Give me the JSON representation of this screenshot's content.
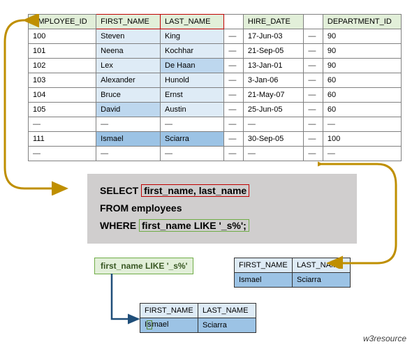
{
  "table": {
    "headers": {
      "id": "EMPLOYEE_ID",
      "fn": "FIRST_NAME",
      "ln": "LAST_NAME",
      "hire": "HIRE_DATE",
      "dept": "DEPARTMENT_ID"
    },
    "rows": [
      {
        "id": "100",
        "fn": "Steven",
        "ln": "King",
        "hire": "17-Jun-03",
        "dept": "90",
        "fn_cls": "lt-blue",
        "ln_cls": "lt-blue"
      },
      {
        "id": "101",
        "fn": "Neena",
        "ln": "Kochhar",
        "hire": "21-Sep-05",
        "dept": "90",
        "fn_cls": "lt-blue",
        "ln_cls": "lt-blue"
      },
      {
        "id": "102",
        "fn": "Lex",
        "ln": "De Haan",
        "hire": "13-Jan-01",
        "dept": "90",
        "fn_cls": "lt-blue",
        "ln_cls": "md-blue"
      },
      {
        "id": "103",
        "fn": "Alexander",
        "ln": "Hunold",
        "hire": "3-Jan-06",
        "dept": "60",
        "fn_cls": "lt-blue",
        "ln_cls": "lt-blue"
      },
      {
        "id": "104",
        "fn": "Bruce",
        "ln": "Ernst",
        "hire": "21-May-07",
        "dept": "60",
        "fn_cls": "lt-blue",
        "ln_cls": "lt-blue"
      },
      {
        "id": "105",
        "fn": "David",
        "ln": "Austin",
        "hire": "25-Jun-05",
        "dept": "60",
        "fn_cls": "md-blue",
        "ln_cls": "lt-blue"
      },
      {
        "id": "",
        "fn": "",
        "ln": "",
        "hire": "",
        "dept": "",
        "fn_cls": "",
        "ln_cls": ""
      },
      {
        "id": "111",
        "fn": "Ismael",
        "ln": "Sciarra",
        "hire": "30-Sep-05",
        "dept": "100",
        "fn_cls": "dk-blue",
        "ln_cls": "dk-blue"
      },
      {
        "id": "",
        "fn": "",
        "ln": "",
        "hire": "",
        "dept": "",
        "fn_cls": "",
        "ln_cls": ""
      }
    ]
  },
  "sql": {
    "select": "SELECT",
    "cols": "first_name, last_name",
    "from": "FROM employees",
    "where": "WHERE",
    "cond": "first_name LIKE '_s%';"
  },
  "label": {
    "cond": "first_name LIKE '_s%'"
  },
  "result": {
    "h1": "FIRST_NAME",
    "h2": "LAST_NAME",
    "fn": "Ismael",
    "ln": "Sciarra",
    "fn_part1": "I",
    "fn_part2": "s",
    "fn_part3": "mael"
  },
  "attribution": "w3resource"
}
